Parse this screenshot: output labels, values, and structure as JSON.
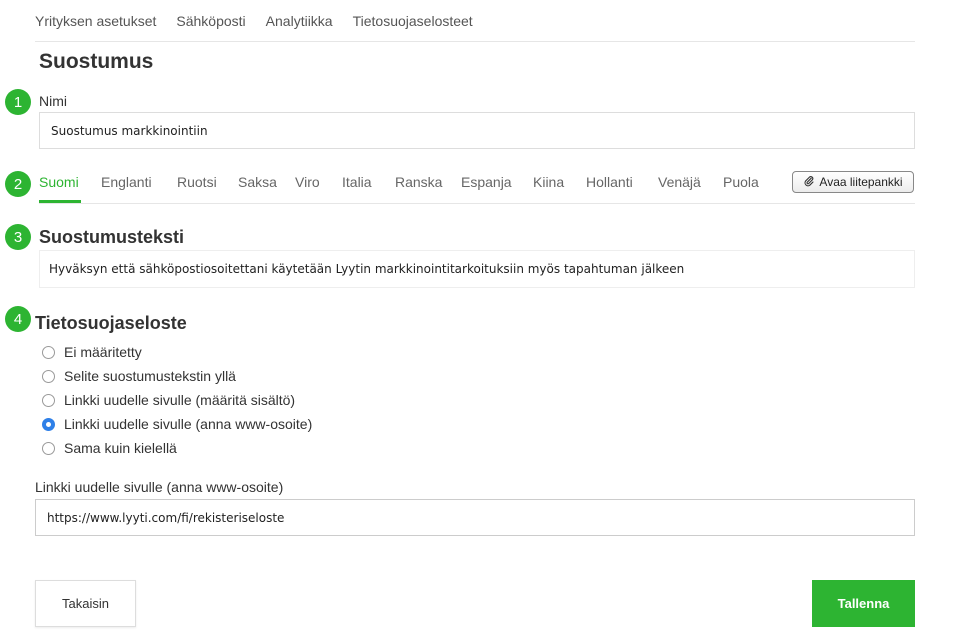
{
  "top_nav": {
    "items": [
      {
        "label": "Yrityksen asetukset"
      },
      {
        "label": "Sähköposti"
      },
      {
        "label": "Analytiikka"
      },
      {
        "label": "Tietosuojaselosteet"
      }
    ]
  },
  "page": {
    "title": "Suostumus"
  },
  "steps": [
    "1",
    "2",
    "3",
    "4"
  ],
  "name_field": {
    "label": "Nimi",
    "value": "Suostumus markkinointiin"
  },
  "languages": {
    "tabs": [
      {
        "label": "Suomi",
        "active": true
      },
      {
        "label": "Englanti"
      },
      {
        "label": "Ruotsi"
      },
      {
        "label": "Saksa"
      },
      {
        "label": "Viro"
      },
      {
        "label": "Italia"
      },
      {
        "label": "Ranska"
      },
      {
        "label": "Espanja"
      },
      {
        "label": "Kiina"
      },
      {
        "label": "Hollanti"
      },
      {
        "label": "Venäjä"
      },
      {
        "label": "Puola"
      }
    ],
    "attach_button": {
      "label": "Avaa liitepankki",
      "icon": "paperclip-icon"
    }
  },
  "consent": {
    "heading": "Suostumusteksti",
    "text": "Hyväksyn että sähköpostiosoitettani käytetään Lyytin markkinointitarkoituksiin myös tapahtuman jälkeen"
  },
  "privacy": {
    "heading": "Tietosuojaseloste",
    "options": [
      {
        "label": "Ei määritetty",
        "checked": false
      },
      {
        "label": "Selite suostumustekstin yllä",
        "checked": false
      },
      {
        "label": "Linkki uudelle sivulle (määritä sisältö)",
        "checked": false
      },
      {
        "label": "Linkki uudelle sivulle (anna www-osoite)",
        "checked": true
      },
      {
        "label": "Sama kuin kielellä",
        "checked": false
      }
    ],
    "url_field": {
      "label": "Linkki uudelle sivulle (anna www-osoite)",
      "value": "https://www.lyyti.com/fi/rekisteriseloste"
    }
  },
  "buttons": {
    "back_label": "Takaisin",
    "save_label": "Tallenna"
  },
  "colors": {
    "accent": "#2db432",
    "radio_selected": "#2f80e8"
  }
}
